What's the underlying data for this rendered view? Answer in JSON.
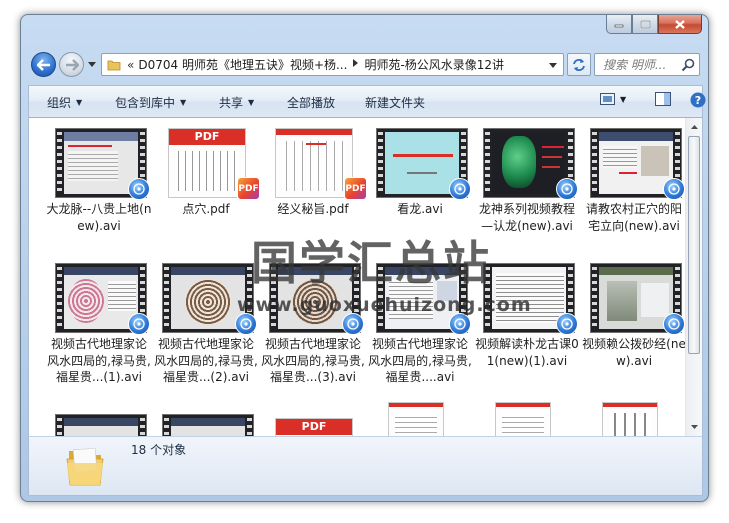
{
  "address": {
    "overflow_chevron": "«",
    "crumbs": [
      "D0704 明师苑《地理五诀》视频+杨...",
      "明师苑-杨公风水录像12讲"
    ]
  },
  "search": {
    "placeholder": "搜索 明师..."
  },
  "toolbar": {
    "organize": "组织",
    "include_in_library": "包含到库中",
    "share": "共享",
    "play_all": "全部播放",
    "new_folder": "新建文件夹"
  },
  "files": [
    {
      "name": "大龙脉--八贵上地(new).avi",
      "type": "video"
    },
    {
      "name": "点穴.pdf",
      "type": "pdf"
    },
    {
      "name": "经义秘旨.pdf",
      "type": "pdf"
    },
    {
      "name": "看龙.avi",
      "type": "video"
    },
    {
      "name": "龙神系列视频教程—认龙(new).avi",
      "type": "video"
    },
    {
      "name": "请教农村正穴的阳宅立向(new).avi",
      "type": "video"
    },
    {
      "name": "视频古代地理家论风水四局的,禄马贵,福星贵...(1).avi",
      "type": "video"
    },
    {
      "name": "视频古代地理家论风水四局的,禄马贵,福星贵...(2).avi",
      "type": "video"
    },
    {
      "name": "视频古代地理家论风水四局的,禄马贵,福星贵...(3).avi",
      "type": "video"
    },
    {
      "name": "视频古代地理家论风水四局的,禄马贵,福星贵....avi",
      "type": "video"
    },
    {
      "name": "视频解读朴龙古课01(new)(1).avi",
      "type": "video"
    },
    {
      "name": "视频赖公拨砂经(new).avi",
      "type": "video"
    }
  ],
  "status": {
    "count_text": "18 个对象"
  },
  "watermark": {
    "title": "国学汇总站",
    "url": "www.guoxuehuizong.com"
  },
  "colors": {
    "pdf_red": "#d92f26",
    "accent_blue": "#2e78d6"
  }
}
